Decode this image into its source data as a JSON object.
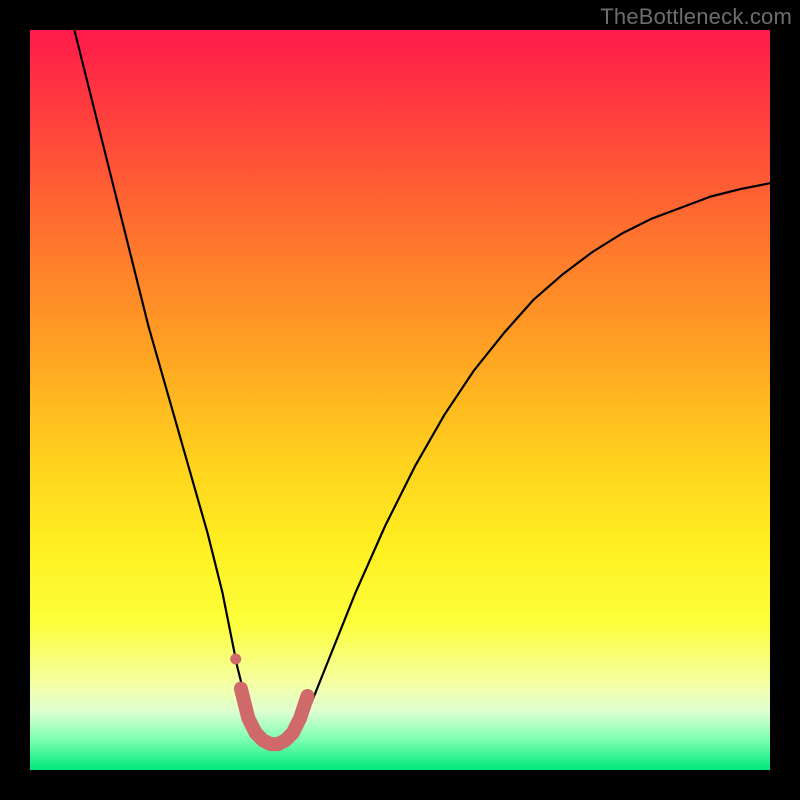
{
  "watermark": {
    "text": "TheBottleneck.com"
  },
  "colors": {
    "curve_stroke": "#000000",
    "marker_stroke": "#d06a6a",
    "marker_fill": "#d06a6a",
    "background": "#000000"
  },
  "chart_data": {
    "type": "line",
    "title": "",
    "xlabel": "",
    "ylabel": "",
    "xlim": [
      0,
      100
    ],
    "ylim": [
      0,
      100
    ],
    "grid": false,
    "legend": false,
    "series": [
      {
        "name": "bottleneck-curve",
        "x": [
          6,
          8,
          10,
          12,
          14,
          16,
          18,
          20,
          22,
          24,
          26,
          27,
          28,
          29,
          30,
          31,
          32,
          33,
          34,
          35,
          36,
          38,
          40,
          44,
          48,
          52,
          56,
          60,
          64,
          68,
          72,
          76,
          80,
          84,
          88,
          92,
          96,
          100
        ],
        "y": [
          100,
          92,
          84,
          76,
          68,
          60,
          53,
          46,
          39,
          32,
          24,
          19,
          14,
          10,
          7,
          5,
          4,
          3.5,
          3.5,
          4,
          5,
          9,
          14,
          24,
          33,
          41,
          48,
          54,
          59,
          63.5,
          67,
          70,
          72.5,
          74.5,
          76,
          77.5,
          78.5,
          79.3
        ]
      }
    ],
    "markers": {
      "name": "optimal-range",
      "color": "#d06a6a",
      "points": [
        {
          "x": 28.5,
          "y": 11
        },
        {
          "x": 29.5,
          "y": 7
        },
        {
          "x": 30.5,
          "y": 5
        },
        {
          "x": 31.5,
          "y": 4
        },
        {
          "x": 32.5,
          "y": 3.5
        },
        {
          "x": 33.5,
          "y": 3.5
        },
        {
          "x": 34.5,
          "y": 4
        },
        {
          "x": 35.5,
          "y": 5
        },
        {
          "x": 36.5,
          "y": 7
        },
        {
          "x": 37.5,
          "y": 10
        }
      ]
    }
  }
}
